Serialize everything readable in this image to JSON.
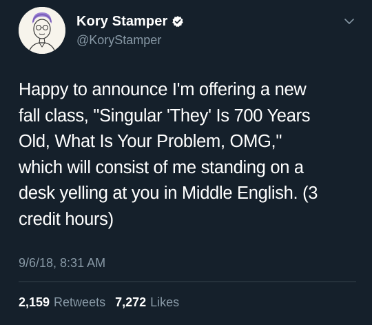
{
  "author": {
    "display_name": "Kory Stamper",
    "handle": "@KoryStamper",
    "verified": true
  },
  "tweet": {
    "text": "Happy to announce I'm offering a new\nfall class, \"Singular 'They' Is 700 Years\nOld, What Is Your Problem, OMG,\"\nwhich will consist of me standing on a\ndesk yelling at you in Middle English. (3\ncredit hours)",
    "timestamp": "9/6/18, 8:31 AM"
  },
  "stats": {
    "retweets_count": "2,159",
    "retweets_label": "Retweets",
    "likes_count": "7,272",
    "likes_label": "Likes"
  },
  "icons": {
    "verified": "verified-badge-icon",
    "menu": "chevron-down-icon"
  },
  "colors": {
    "background": "#15202b",
    "primary_text": "#ffffff",
    "secondary_text": "#8899a6",
    "verified_blue": "#1da1f2",
    "divider": "#38444d"
  }
}
